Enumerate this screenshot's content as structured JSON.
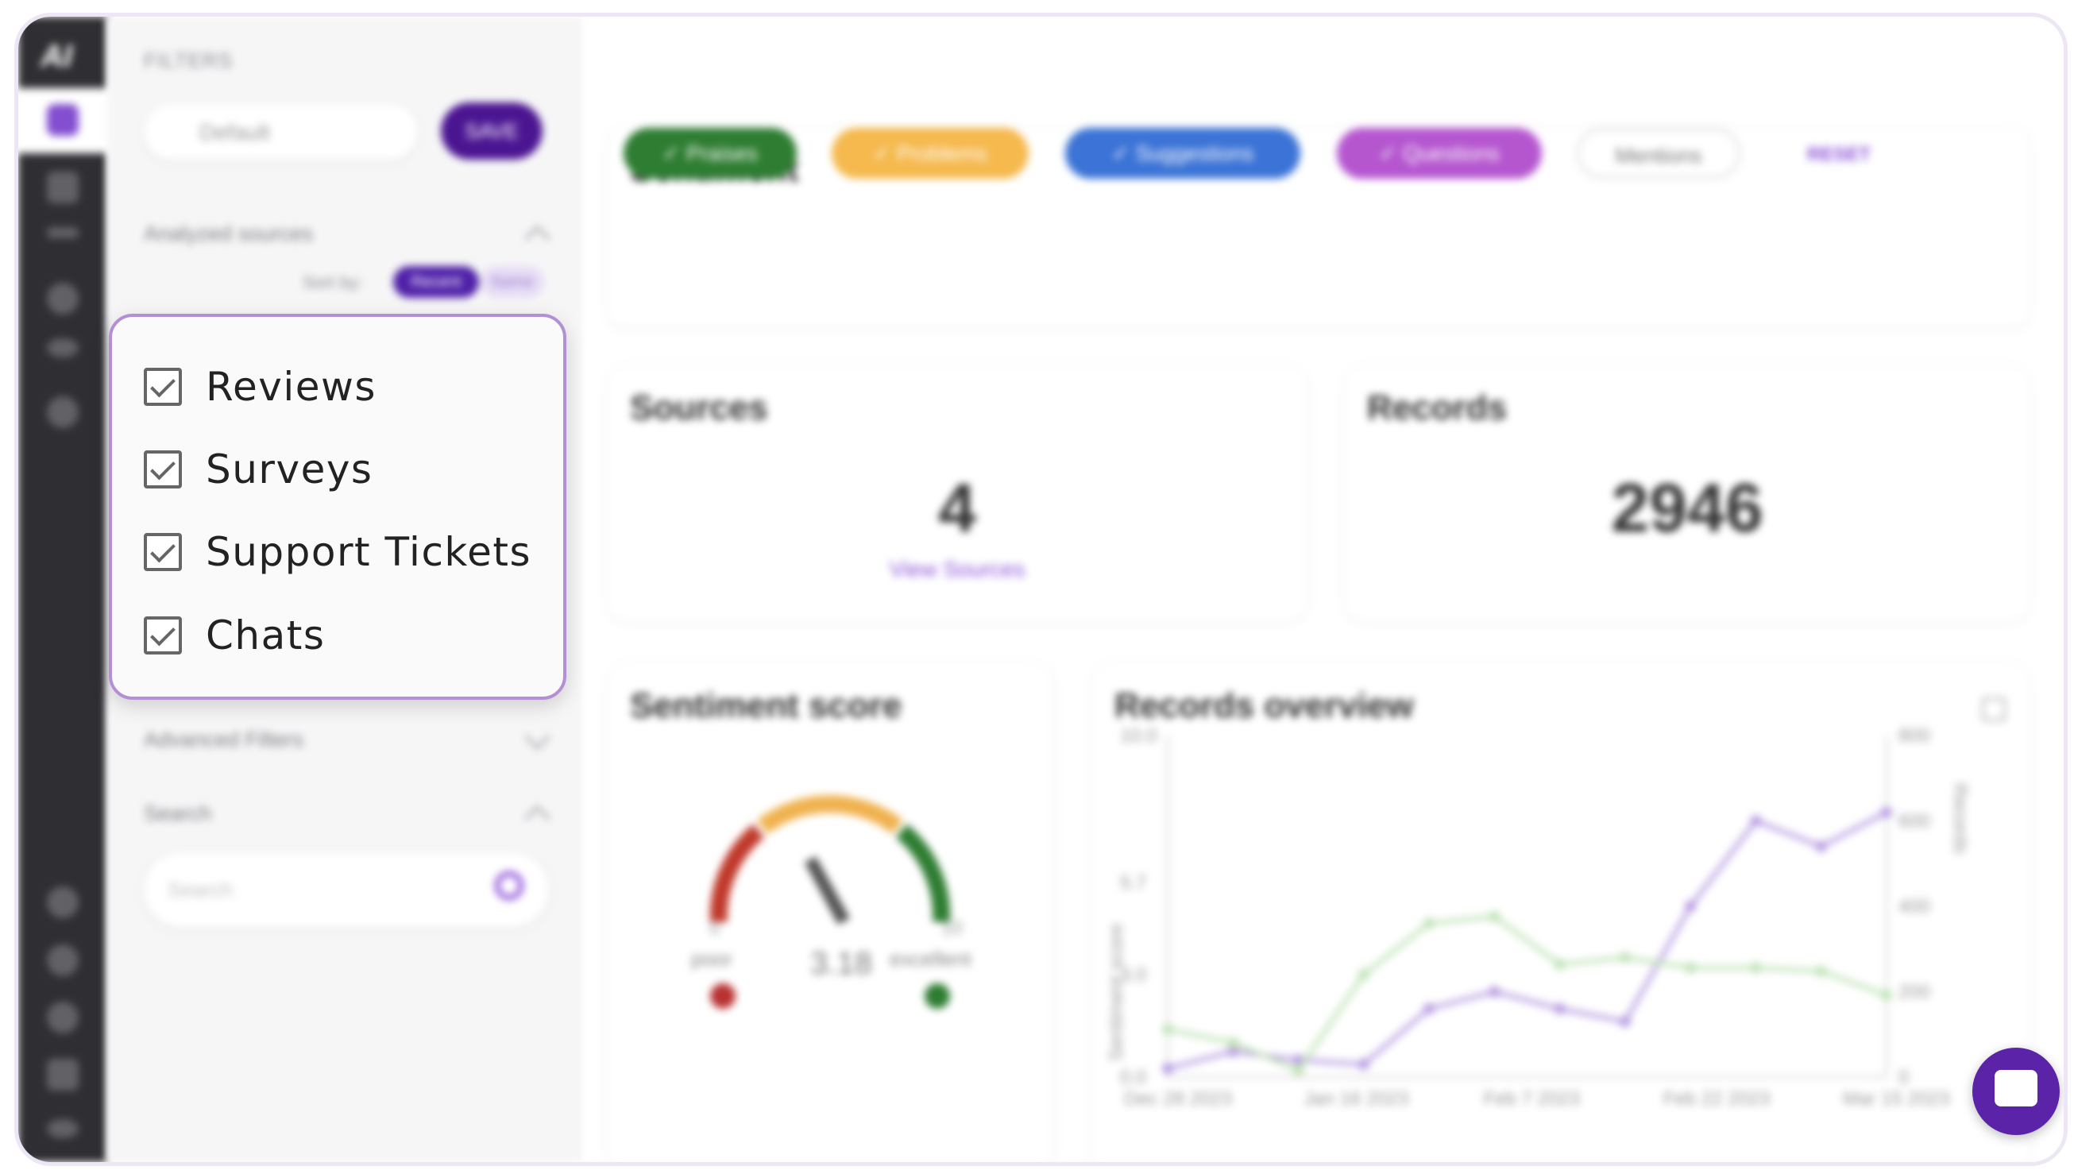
{
  "popup": {
    "options": [
      {
        "label": "Reviews",
        "checked": true
      },
      {
        "label": "Surveys",
        "checked": true
      },
      {
        "label": "Support Tickets",
        "checked": true
      },
      {
        "label": "Chats",
        "checked": true
      }
    ]
  },
  "sidebar": {
    "logo": "AI",
    "filters_title": "FILTERS",
    "preset_value": "Default",
    "save_label": "SAVE",
    "analyzed_sources_title": "Analyzed sources",
    "sort_by_label": "Sort by:",
    "sort_options": [
      "Recent",
      "Name"
    ],
    "advanced_filters_title": "Advanced Filters",
    "search_title": "Search",
    "search_placeholder": "Search"
  },
  "main": {
    "sentiment": {
      "title": "Sentiment",
      "chips": [
        {
          "label": "✓ Praises",
          "color": "#2e7d32"
        },
        {
          "label": "✓ Problems",
          "color": "#f5b94e"
        },
        {
          "label": "✓ Suggestions",
          "color": "#3b73d6"
        },
        {
          "label": "✓ Questions",
          "color": "#b556cf"
        },
        {
          "label": "Mentions",
          "color": "#ffffff"
        }
      ],
      "reset_label": "RESET"
    },
    "sources": {
      "title": "Sources",
      "value": "4",
      "link": "View Sources"
    },
    "records": {
      "title": "Records",
      "value": "2946"
    },
    "sentiment_score": {
      "title": "Sentiment score",
      "value": "3.18",
      "min_label": "0",
      "max_label": "10",
      "poor_label": "poor",
      "excellent_label": "excellent"
    },
    "records_overview": {
      "title": "Records overview"
    }
  },
  "chart_data": {
    "type": "line",
    "title": "Records overview",
    "ylabel": "Sentiment score",
    "y2label": "Records",
    "x_tick_labels": [
      "Dec 28 2023",
      "Jan 16 2023",
      "Feb 7 2023",
      "Feb 22 2023",
      "Mar 15 2023"
    ],
    "y_ticks": [
      "0.0",
      "3.0",
      "5.7",
      "10.0"
    ],
    "y2_ticks": [
      "0",
      "200",
      "400",
      "600",
      "800"
    ],
    "ylim": [
      0,
      10
    ],
    "y2lim": [
      0,
      800
    ],
    "series": [
      {
        "axis": "y2",
        "color": "#b79be0",
        "values": [
          20,
          60,
          40,
          30,
          160,
          200,
          160,
          130,
          400,
          600,
          540,
          620
        ]
      },
      {
        "axis": "y",
        "color": "#bfe2b6",
        "values": [
          1.4,
          1.0,
          0.2,
          3.0,
          4.5,
          4.7,
          3.3,
          3.5,
          3.2,
          3.2,
          3.1,
          2.4
        ]
      }
    ]
  }
}
